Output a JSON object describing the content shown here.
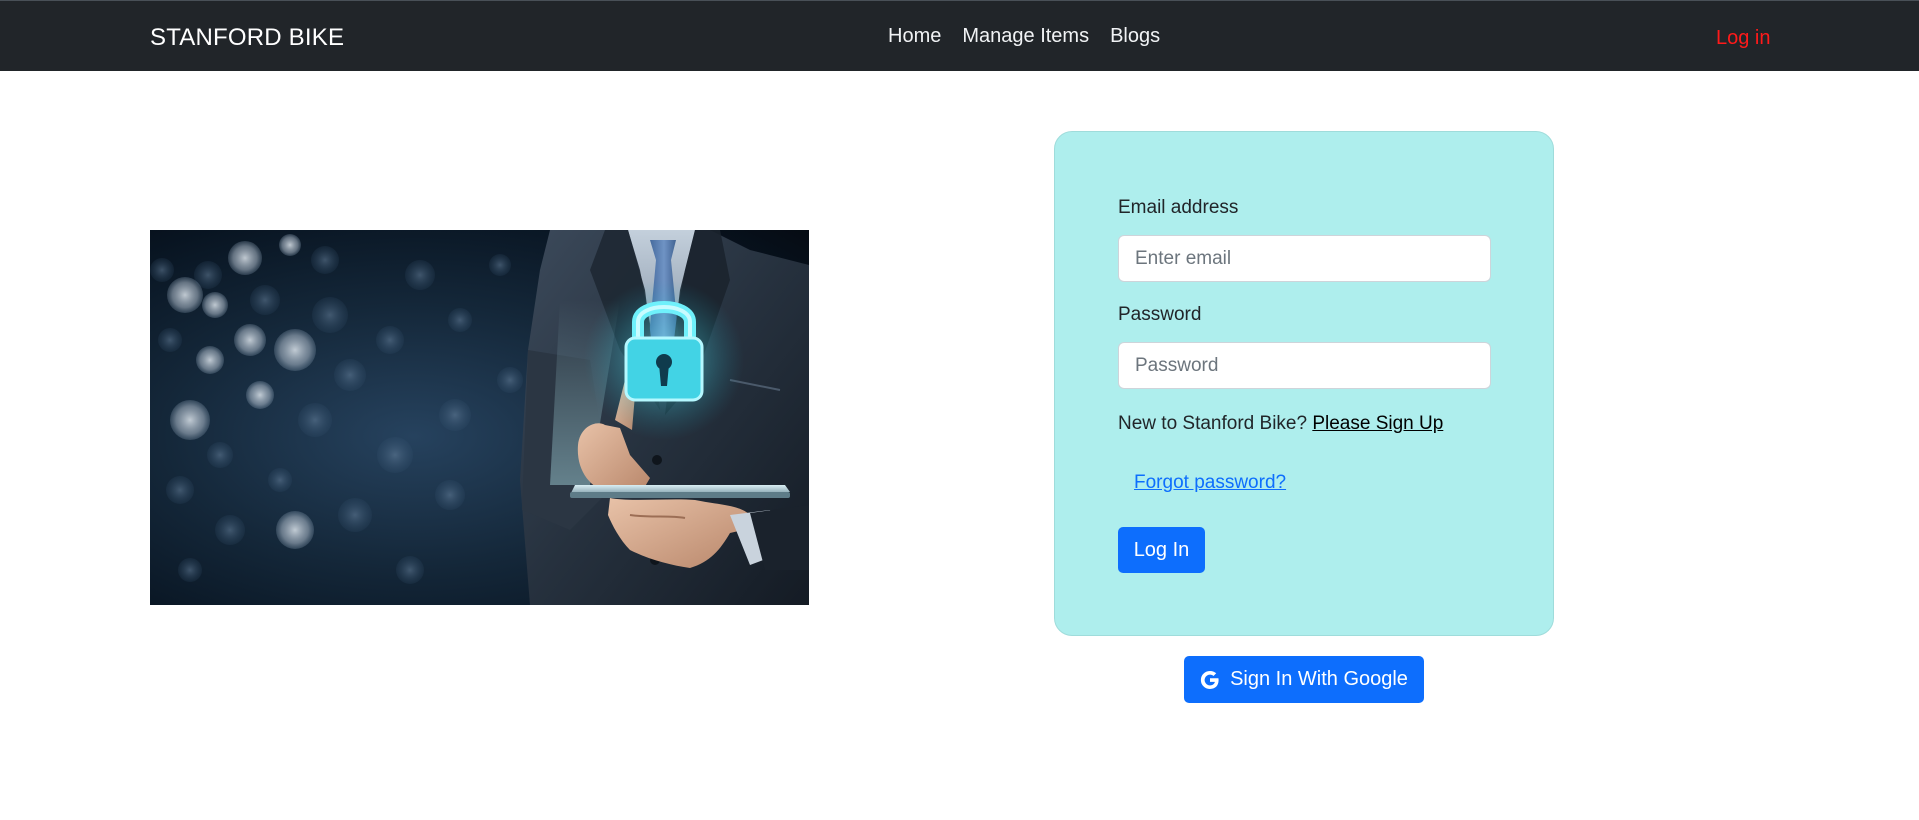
{
  "navbar": {
    "brand": "STANFORD BIKE",
    "links": [
      {
        "label": "Home"
      },
      {
        "label": "Manage Items"
      },
      {
        "label": "Blogs"
      }
    ],
    "login_label": "Log in",
    "login_color": "#ff1a1a",
    "background": "#212529"
  },
  "hero": {
    "icon": "padlock-icon"
  },
  "login_form": {
    "email_label": "Email address",
    "email_placeholder": "Enter email",
    "email_value": "",
    "password_label": "Password",
    "password_placeholder": "Password",
    "password_value": "",
    "signup_prompt": "New to Stanford Bike?",
    "signup_link": "Please Sign Up",
    "forgot_link": "Forgot password?",
    "submit_label": "Log In",
    "card_color": "#aeeeed",
    "accent_color": "#0d6efd"
  },
  "google": {
    "icon": "google-icon",
    "label": "Sign In With Google"
  }
}
